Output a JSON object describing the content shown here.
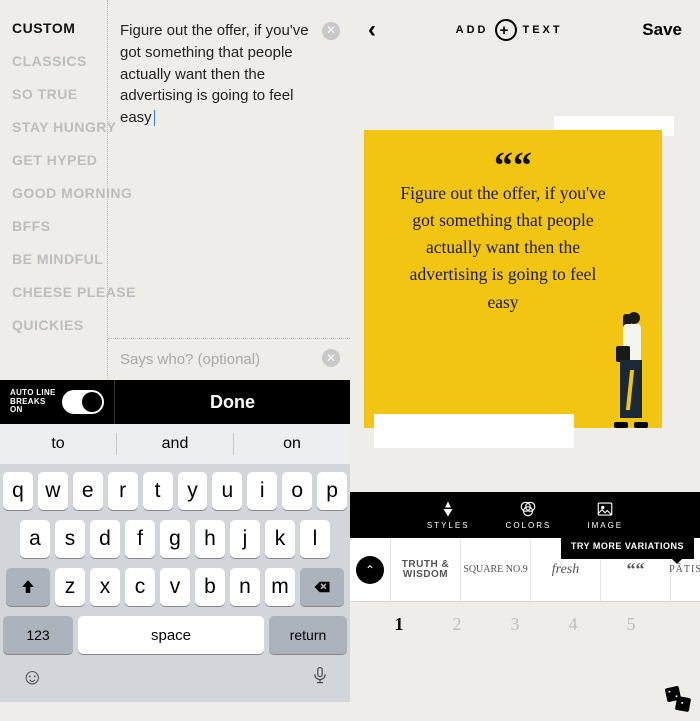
{
  "left": {
    "categories": [
      "Custom",
      "Classics",
      "So True",
      "Stay Hungry",
      "Get Hyped",
      "Good Morning",
      "BFFs",
      "Be Mindful",
      "Cheese Please",
      "Quickies"
    ],
    "active_category": 0,
    "main_text": "Figure out the offer, if you've got something that people actually want then the advertising is going to feel easy",
    "attribution_placeholder": "Says who? (optional)",
    "auto_line_breaks_label": "AUTO LINE BREAKS ON",
    "done_label": "Done"
  },
  "keyboard": {
    "suggestions": [
      "to",
      "and",
      "on"
    ],
    "row1": [
      "q",
      "w",
      "e",
      "r",
      "t",
      "y",
      "u",
      "i",
      "o",
      "p"
    ],
    "row2": [
      "a",
      "s",
      "d",
      "f",
      "g",
      "h",
      "j",
      "k",
      "l"
    ],
    "row3": [
      "z",
      "x",
      "c",
      "v",
      "b",
      "n",
      "m"
    ],
    "numeric_label": "123",
    "space_label": "space",
    "return_label": "return"
  },
  "right": {
    "add_text_label_left": "ADD",
    "add_text_label_right": "TEXT",
    "save_label": "Save",
    "quote_mark": "““",
    "quote_text": "Figure out the offer, if you've got something that people actually want then the advertising is going to feel easy",
    "tabs": {
      "styles": "STYLES",
      "colors": "COLORS",
      "image": "IMAGE"
    },
    "thumbs": [
      "TRUTH & WISDOM",
      "SQUARE NO.9",
      "fresh",
      "““",
      "PÂTIS"
    ],
    "try_more_label": "TRY MORE VARIATIONS",
    "pages": [
      "1",
      "2",
      "3",
      "4",
      "5"
    ],
    "active_page": 0
  }
}
